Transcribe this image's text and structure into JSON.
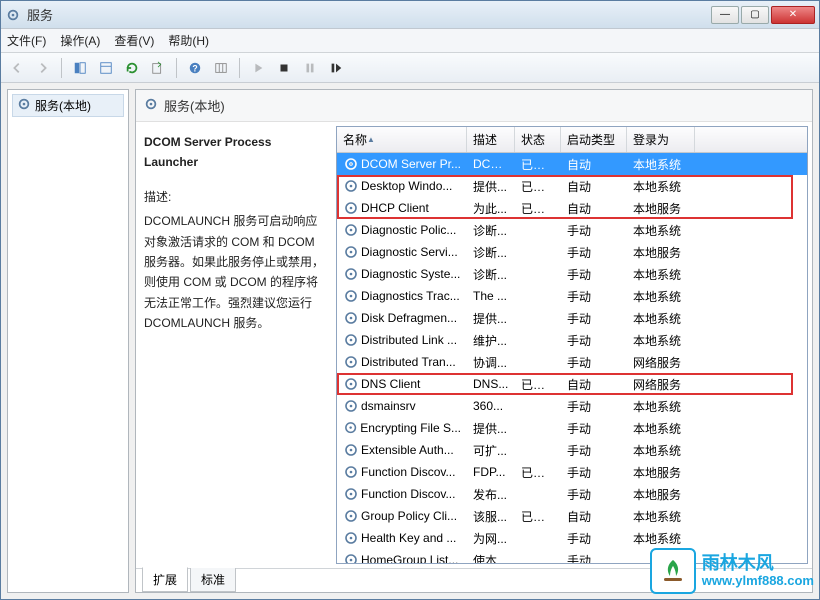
{
  "titlebar": {
    "title": "服务"
  },
  "menus": {
    "file": "文件(F)",
    "action": "操作(A)",
    "view": "查看(V)",
    "help": "帮助(H)"
  },
  "leftTree": {
    "root": "服务(本地)"
  },
  "rightHeader": "服务(本地)",
  "description": {
    "title": "DCOM Server Process Launcher",
    "subhead": "描述:",
    "body": "DCOMLAUNCH 服务可启动响应对象激活请求的 COM 和 DCOM 服务器。如果此服务停止或禁用，则使用 COM 或 DCOM 的程序将无法正常工作。强烈建议您运行 DCOMLAUNCH 服务。"
  },
  "columns": {
    "name": "名称",
    "desc": "描述",
    "status": "状态",
    "type": "启动类型",
    "logon": "登录为"
  },
  "services": [
    {
      "name": "DCOM Server Pr...",
      "desc": "DCO...",
      "status": "已启动",
      "type": "自动",
      "logon": "本地系统",
      "selected": true
    },
    {
      "name": "Desktop Windo...",
      "desc": "提供...",
      "status": "已启动",
      "type": "自动",
      "logon": "本地系统",
      "highlight": 1
    },
    {
      "name": "DHCP Client",
      "desc": "为此...",
      "status": "已启动",
      "type": "自动",
      "logon": "本地服务",
      "highlight": 1
    },
    {
      "name": "Diagnostic Polic...",
      "desc": "诊断...",
      "status": "",
      "type": "手动",
      "logon": "本地系统"
    },
    {
      "name": "Diagnostic Servi...",
      "desc": "诊断...",
      "status": "",
      "type": "手动",
      "logon": "本地服务"
    },
    {
      "name": "Diagnostic Syste...",
      "desc": "诊断...",
      "status": "",
      "type": "手动",
      "logon": "本地系统"
    },
    {
      "name": "Diagnostics Trac...",
      "desc": "The ...",
      "status": "",
      "type": "手动",
      "logon": "本地系统"
    },
    {
      "name": "Disk Defragmen...",
      "desc": "提供...",
      "status": "",
      "type": "手动",
      "logon": "本地系统"
    },
    {
      "name": "Distributed Link ...",
      "desc": "维护...",
      "status": "",
      "type": "手动",
      "logon": "本地系统"
    },
    {
      "name": "Distributed Tran...",
      "desc": "协调...",
      "status": "",
      "type": "手动",
      "logon": "网络服务"
    },
    {
      "name": "DNS Client",
      "desc": "DNS...",
      "status": "已启动",
      "type": "自动",
      "logon": "网络服务",
      "highlight": 2
    },
    {
      "name": "dsmainsrv",
      "desc": "360...",
      "status": "",
      "type": "手动",
      "logon": "本地系统"
    },
    {
      "name": "Encrypting File S...",
      "desc": "提供...",
      "status": "",
      "type": "手动",
      "logon": "本地系统"
    },
    {
      "name": "Extensible Auth...",
      "desc": "可扩...",
      "status": "",
      "type": "手动",
      "logon": "本地系统"
    },
    {
      "name": "Function Discov...",
      "desc": "FDP...",
      "status": "已启动",
      "type": "手动",
      "logon": "本地服务"
    },
    {
      "name": "Function Discov...",
      "desc": "发布...",
      "status": "",
      "type": "手动",
      "logon": "本地服务"
    },
    {
      "name": "Group Policy Cli...",
      "desc": "该服...",
      "status": "已启动",
      "type": "自动",
      "logon": "本地系统"
    },
    {
      "name": "Health Key and ...",
      "desc": "为网...",
      "status": "",
      "type": "手动",
      "logon": "本地系统"
    },
    {
      "name": "HomeGroup List...",
      "desc": "使本...",
      "status": "",
      "type": "手动",
      "logon": ""
    }
  ],
  "tabs": {
    "extended": "扩展",
    "standard": "标准"
  },
  "watermark": {
    "cn": "雨林木风",
    "url": "www.ylmf888.com"
  }
}
